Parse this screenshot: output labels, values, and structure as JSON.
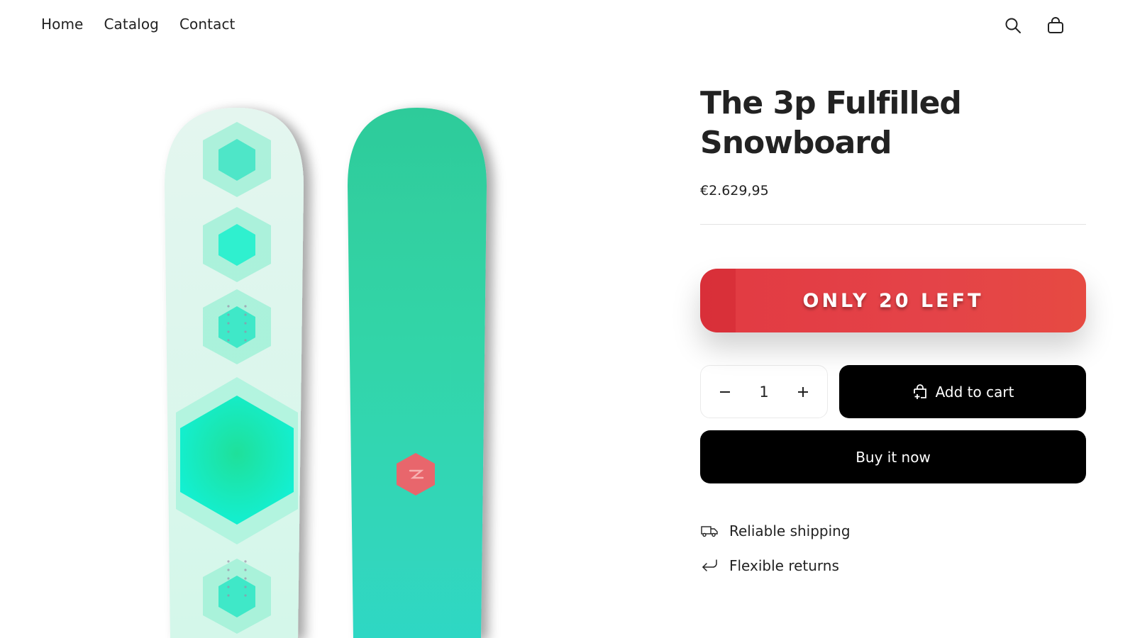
{
  "nav": {
    "items": [
      {
        "label": "Home"
      },
      {
        "label": "Catalog"
      },
      {
        "label": "Contact"
      }
    ]
  },
  "header_icons": [
    "search-icon",
    "cart-icon"
  ],
  "product": {
    "title": "The 3p Fulfilled Snowboard",
    "price": "€2.629,95",
    "stock_badge": "ONLY 20 LEFT",
    "quantity": "1",
    "add_to_cart_label": "Add to cart",
    "buy_now_label": "Buy it now",
    "features": [
      {
        "icon": "truck-icon",
        "label": "Reliable shipping"
      },
      {
        "icon": "return-arrow-icon",
        "label": "Flexible returns"
      }
    ]
  },
  "colors": {
    "accent_red": "#e23a42",
    "button_black": "#000000",
    "board_mint": "#2fd6ad",
    "board_pale": "#dff7ee",
    "logo_red": "#e86a6a"
  }
}
